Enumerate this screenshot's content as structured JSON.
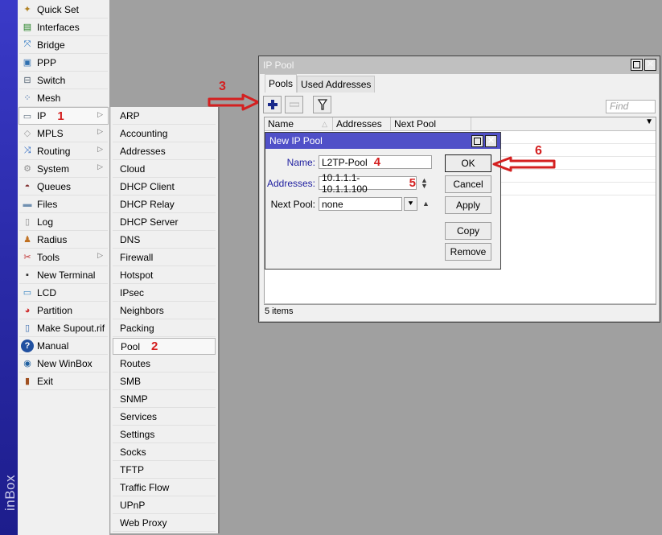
{
  "app": {
    "brand_text": "inBox"
  },
  "main_menu": {
    "items": [
      {
        "label": "Quick Set",
        "icon": "wand-icon",
        "submenu": false
      },
      {
        "label": "Interfaces",
        "icon": "network-card-icon",
        "submenu": false
      },
      {
        "label": "Bridge",
        "icon": "bridge-icon",
        "submenu": false
      },
      {
        "label": "PPP",
        "icon": "ppp-icon",
        "submenu": false
      },
      {
        "label": "Switch",
        "icon": "switch-icon",
        "submenu": false
      },
      {
        "label": "Mesh",
        "icon": "mesh-icon",
        "submenu": false
      },
      {
        "label": "IP",
        "icon": "ip-icon",
        "submenu": true,
        "annotation": "1",
        "active": true
      },
      {
        "label": "MPLS",
        "icon": "tag-icon",
        "submenu": true
      },
      {
        "label": "Routing",
        "icon": "routing-icon",
        "submenu": true
      },
      {
        "label": "System",
        "icon": "gear-icon",
        "submenu": true
      },
      {
        "label": "Queues",
        "icon": "gauge-icon",
        "submenu": false
      },
      {
        "label": "Files",
        "icon": "folder-icon",
        "submenu": false
      },
      {
        "label": "Log",
        "icon": "document-icon",
        "submenu": false
      },
      {
        "label": "Radius",
        "icon": "users-icon",
        "submenu": false
      },
      {
        "label": "Tools",
        "icon": "tools-icon",
        "submenu": true
      },
      {
        "label": "New Terminal",
        "icon": "terminal-icon",
        "submenu": false
      },
      {
        "label": "LCD",
        "icon": "monitor-icon",
        "submenu": false
      },
      {
        "label": "Partition",
        "icon": "pie-icon",
        "submenu": false
      },
      {
        "label": "Make Supout.rif",
        "icon": "file-export-icon",
        "submenu": false
      },
      {
        "label": "Manual",
        "icon": "help-icon",
        "submenu": false
      },
      {
        "label": "New WinBox",
        "icon": "winbox-icon",
        "submenu": false
      },
      {
        "label": "Exit",
        "icon": "exit-door-icon",
        "submenu": false
      }
    ]
  },
  "ip_submenu": {
    "items": [
      {
        "label": "ARP"
      },
      {
        "label": "Accounting"
      },
      {
        "label": "Addresses"
      },
      {
        "label": "Cloud"
      },
      {
        "label": "DHCP Client"
      },
      {
        "label": "DHCP Relay"
      },
      {
        "label": "DHCP Server"
      },
      {
        "label": "DNS"
      },
      {
        "label": "Firewall"
      },
      {
        "label": "Hotspot"
      },
      {
        "label": "IPsec"
      },
      {
        "label": "Neighbors"
      },
      {
        "label": "Packing"
      },
      {
        "label": "Pool",
        "annotation": "2",
        "active": true
      },
      {
        "label": "Routes"
      },
      {
        "label": "SMB"
      },
      {
        "label": "SNMP"
      },
      {
        "label": "Services"
      },
      {
        "label": "Settings"
      },
      {
        "label": "Socks"
      },
      {
        "label": "TFTP"
      },
      {
        "label": "Traffic Flow"
      },
      {
        "label": "UPnP"
      },
      {
        "label": "Web Proxy"
      }
    ]
  },
  "annotations": {
    "step3": "3",
    "step6": "6",
    "color": "#d42020"
  },
  "ip_pool_window": {
    "title": "IP Pool",
    "tabs": [
      {
        "label": "Pools",
        "active": true
      },
      {
        "label": "Used Addresses",
        "active": false
      }
    ],
    "toolbar": {
      "add_icon": "plus-icon",
      "remove_icon": "minus-icon",
      "filter_icon": "filter-icon"
    },
    "find_placeholder": "Find",
    "columns": [
      "Name",
      "Addresses",
      "Next Pool"
    ],
    "status": "5 items"
  },
  "new_pool_dialog": {
    "title": "New IP Pool",
    "fields": {
      "name": {
        "label": "Name:",
        "value": "L2TP-Pool",
        "annotation": "4"
      },
      "addresses": {
        "label": "Addresses:",
        "value": "10.1.1.1-10.1.1.100",
        "annotation": "5"
      },
      "next_pool": {
        "label": "Next Pool:",
        "value": "none"
      }
    },
    "buttons": {
      "ok": "OK",
      "cancel": "Cancel",
      "apply": "Apply",
      "copy": "Copy",
      "remove": "Remove"
    }
  },
  "colors": {
    "desktop": "#a0a0a0",
    "dialog_title": "#5050c8",
    "brand_bar": "#2a2aa8"
  }
}
